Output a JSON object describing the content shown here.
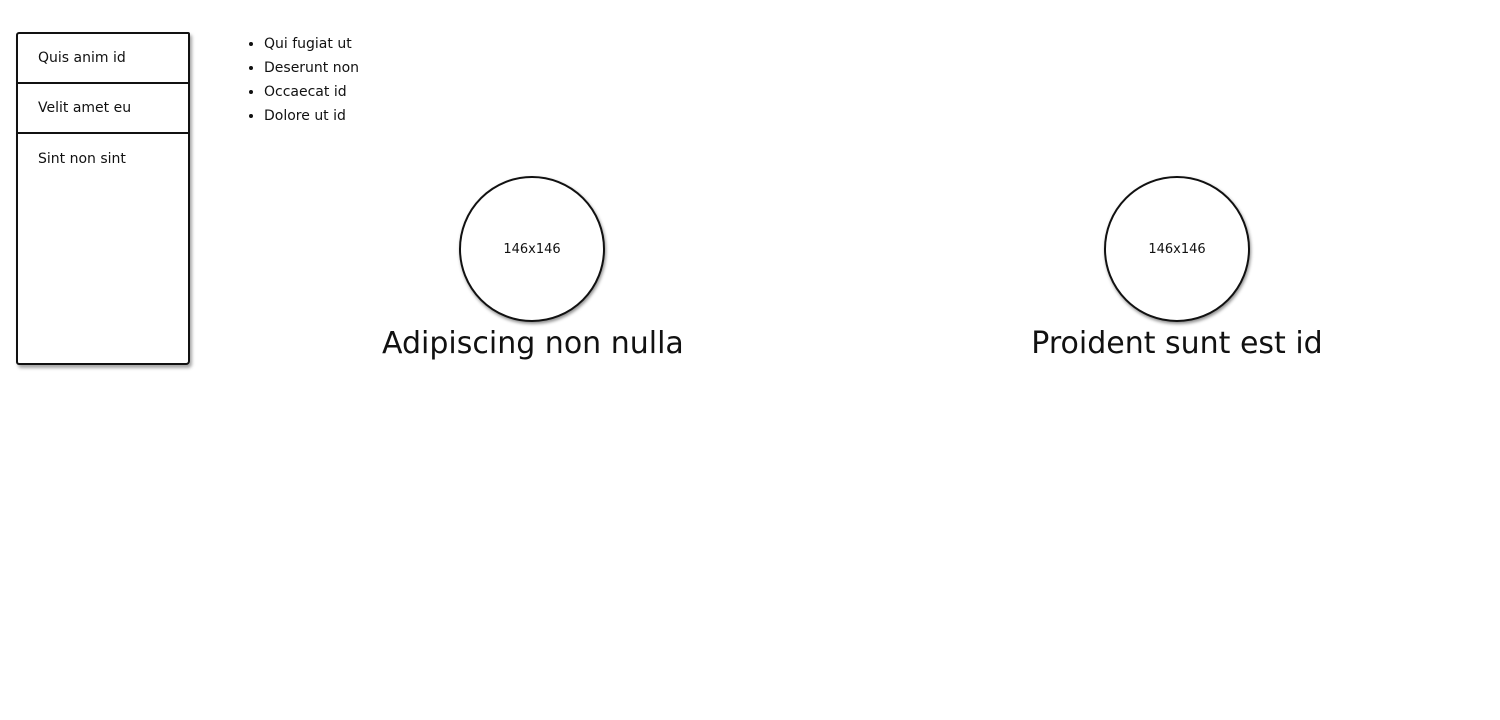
{
  "nav": {
    "items": [
      {
        "label": "Quis anim id"
      },
      {
        "label": "Velit amet eu"
      },
      {
        "label": "Sint non sint"
      }
    ]
  },
  "list": {
    "items": [
      "Qui fugiat ut",
      "Deserunt non",
      "Occaecat id",
      "Dolore ut id"
    ]
  },
  "images": [
    {
      "placeholder": "146x146",
      "caption": "Adipiscing non nulla"
    },
    {
      "placeholder": "146x146",
      "caption": "Proident sunt est id"
    }
  ]
}
